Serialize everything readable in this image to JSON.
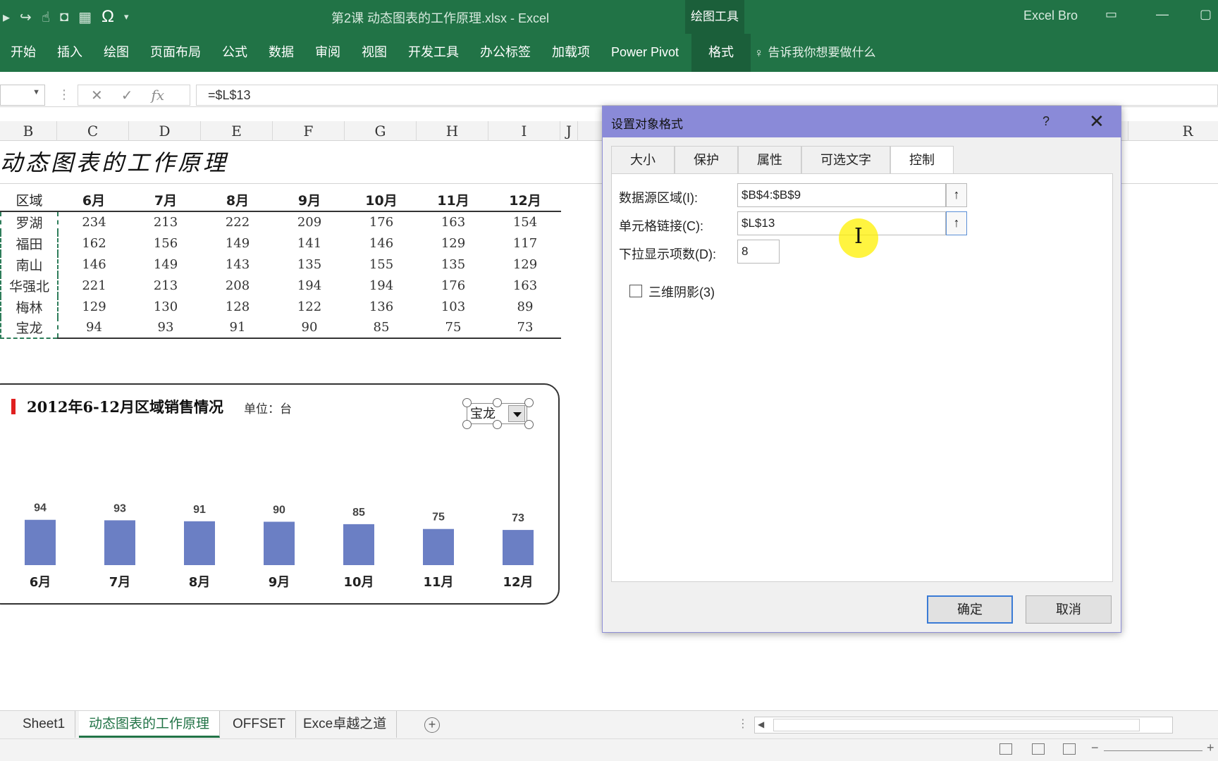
{
  "window": {
    "title": "第2课  动态图表的工作原理.xlsx  -  Excel",
    "context_tab": "绘图工具",
    "user": "Excel Bro"
  },
  "qat_icons": [
    "save-icon",
    "undo-icon",
    "redo-icon",
    "touch-mode-icon",
    "camera-icon",
    "calculator-icon",
    "omega-icon",
    "customize-qat-icon"
  ],
  "ribbon": {
    "tabs": [
      "开始",
      "插入",
      "绘图",
      "页面布局",
      "公式",
      "数据",
      "审阅",
      "视图",
      "开发工具",
      "办公标签",
      "加载项",
      "Power Pivot",
      "格式"
    ],
    "active_tab": "格式",
    "tell_me": "告诉我你想要做什么"
  },
  "formula_bar": {
    "name_box": "",
    "formula": "=$L$13",
    "cancel": "✕",
    "enter": "✓",
    "fx": "fx"
  },
  "columns": [
    "B",
    "C",
    "D",
    "E",
    "F",
    "G",
    "H",
    "I",
    "J",
    "R"
  ],
  "sheet": {
    "title": "动态图表的工作原理",
    "region_header": "区域",
    "months": [
      "6月",
      "7月",
      "8月",
      "9月",
      "10月",
      "11月",
      "12月"
    ],
    "rows": [
      {
        "region": "罗湖",
        "values": [
          234,
          213,
          222,
          209,
          176,
          163,
          154
        ]
      },
      {
        "region": "福田",
        "values": [
          162,
          156,
          149,
          141,
          146,
          129,
          117
        ]
      },
      {
        "region": "南山",
        "values": [
          146,
          149,
          143,
          135,
          155,
          135,
          129
        ]
      },
      {
        "region": "华强北",
        "values": [
          221,
          213,
          208,
          194,
          194,
          176,
          163
        ]
      },
      {
        "region": "梅林",
        "values": [
          129,
          130,
          128,
          122,
          136,
          103,
          89
        ]
      },
      {
        "region": "宝龙",
        "values": [
          94,
          93,
          91,
          90,
          85,
          75,
          73
        ]
      }
    ]
  },
  "chart_data": {
    "type": "bar",
    "title": "2012年6-12月区域销售情况",
    "unit": "单位：台",
    "categories": [
      "6月",
      "7月",
      "8月",
      "9月",
      "10月",
      "11月",
      "12月"
    ],
    "series": [
      {
        "values": [
          94,
          93,
          91,
          90,
          85,
          75,
          73
        ]
      }
    ],
    "bar_color": "#6b7fc4",
    "title_marker_color": "#e02020",
    "value_max": 234,
    "data_labels": true,
    "axes_visible": false,
    "gridlines": false
  },
  "combo_box": {
    "selected": "宝龙"
  },
  "dialog": {
    "title": "设置对象格式",
    "help": "?",
    "tabs": [
      "大小",
      "保护",
      "属性",
      "可选文字",
      "控制"
    ],
    "active_tab": "控制",
    "input_range_label": "数据源区域(I):",
    "input_range_value": "$B$4:$B$9",
    "cell_link_label": "单元格链接(C):",
    "cell_link_value": "$L$13",
    "dropdown_lines_label": "下拉显示项数(D):",
    "dropdown_lines_value": "8",
    "shading_3d_label": "三维阴影(3)",
    "shading_3d_checked": false,
    "ok_label": "确定",
    "cancel_label": "取消",
    "accent_color": "#8a8ad8"
  },
  "sheet_tabs": {
    "tabs": [
      "Sheet1",
      "动态图表的工作原理",
      "OFFSET",
      "Exce卓越之道"
    ],
    "active": "动态图表的工作原理"
  },
  "colors": {
    "excel_green": "#217346",
    "context_tab_bg": "#1b5f3a",
    "selection_border": "#2e7d5a"
  }
}
